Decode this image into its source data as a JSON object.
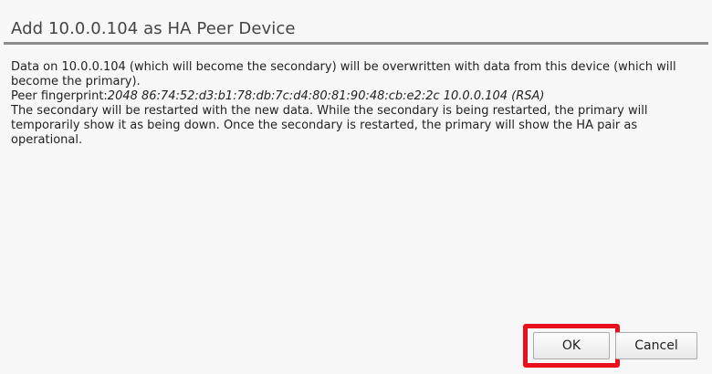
{
  "dialog": {
    "title": "Add 10.0.0.104 as HA Peer Device",
    "paragraph1": "Data on 10.0.0.104 (which will become the secondary) will be overwritten with data from this device (which will become the primary).",
    "fingerprint_label": "Peer fingerprint:",
    "fingerprint_value": "2048 86:74:52:d3:b1:78:db:7c:d4:80:81:90:48:cb:e2:2c 10.0.0.104 (RSA)",
    "paragraph2": "The secondary will be restarted with the new data. While the secondary is being restarted, the primary will temporarily show it as being down. Once the secondary is restarted, the primary will show the HA pair as operational."
  },
  "buttons": {
    "ok_label": "OK",
    "cancel_label": "Cancel"
  },
  "colors": {
    "highlight": "#e8101a",
    "title_rule": "#8c8c8c",
    "background": "#f7f7f7"
  }
}
